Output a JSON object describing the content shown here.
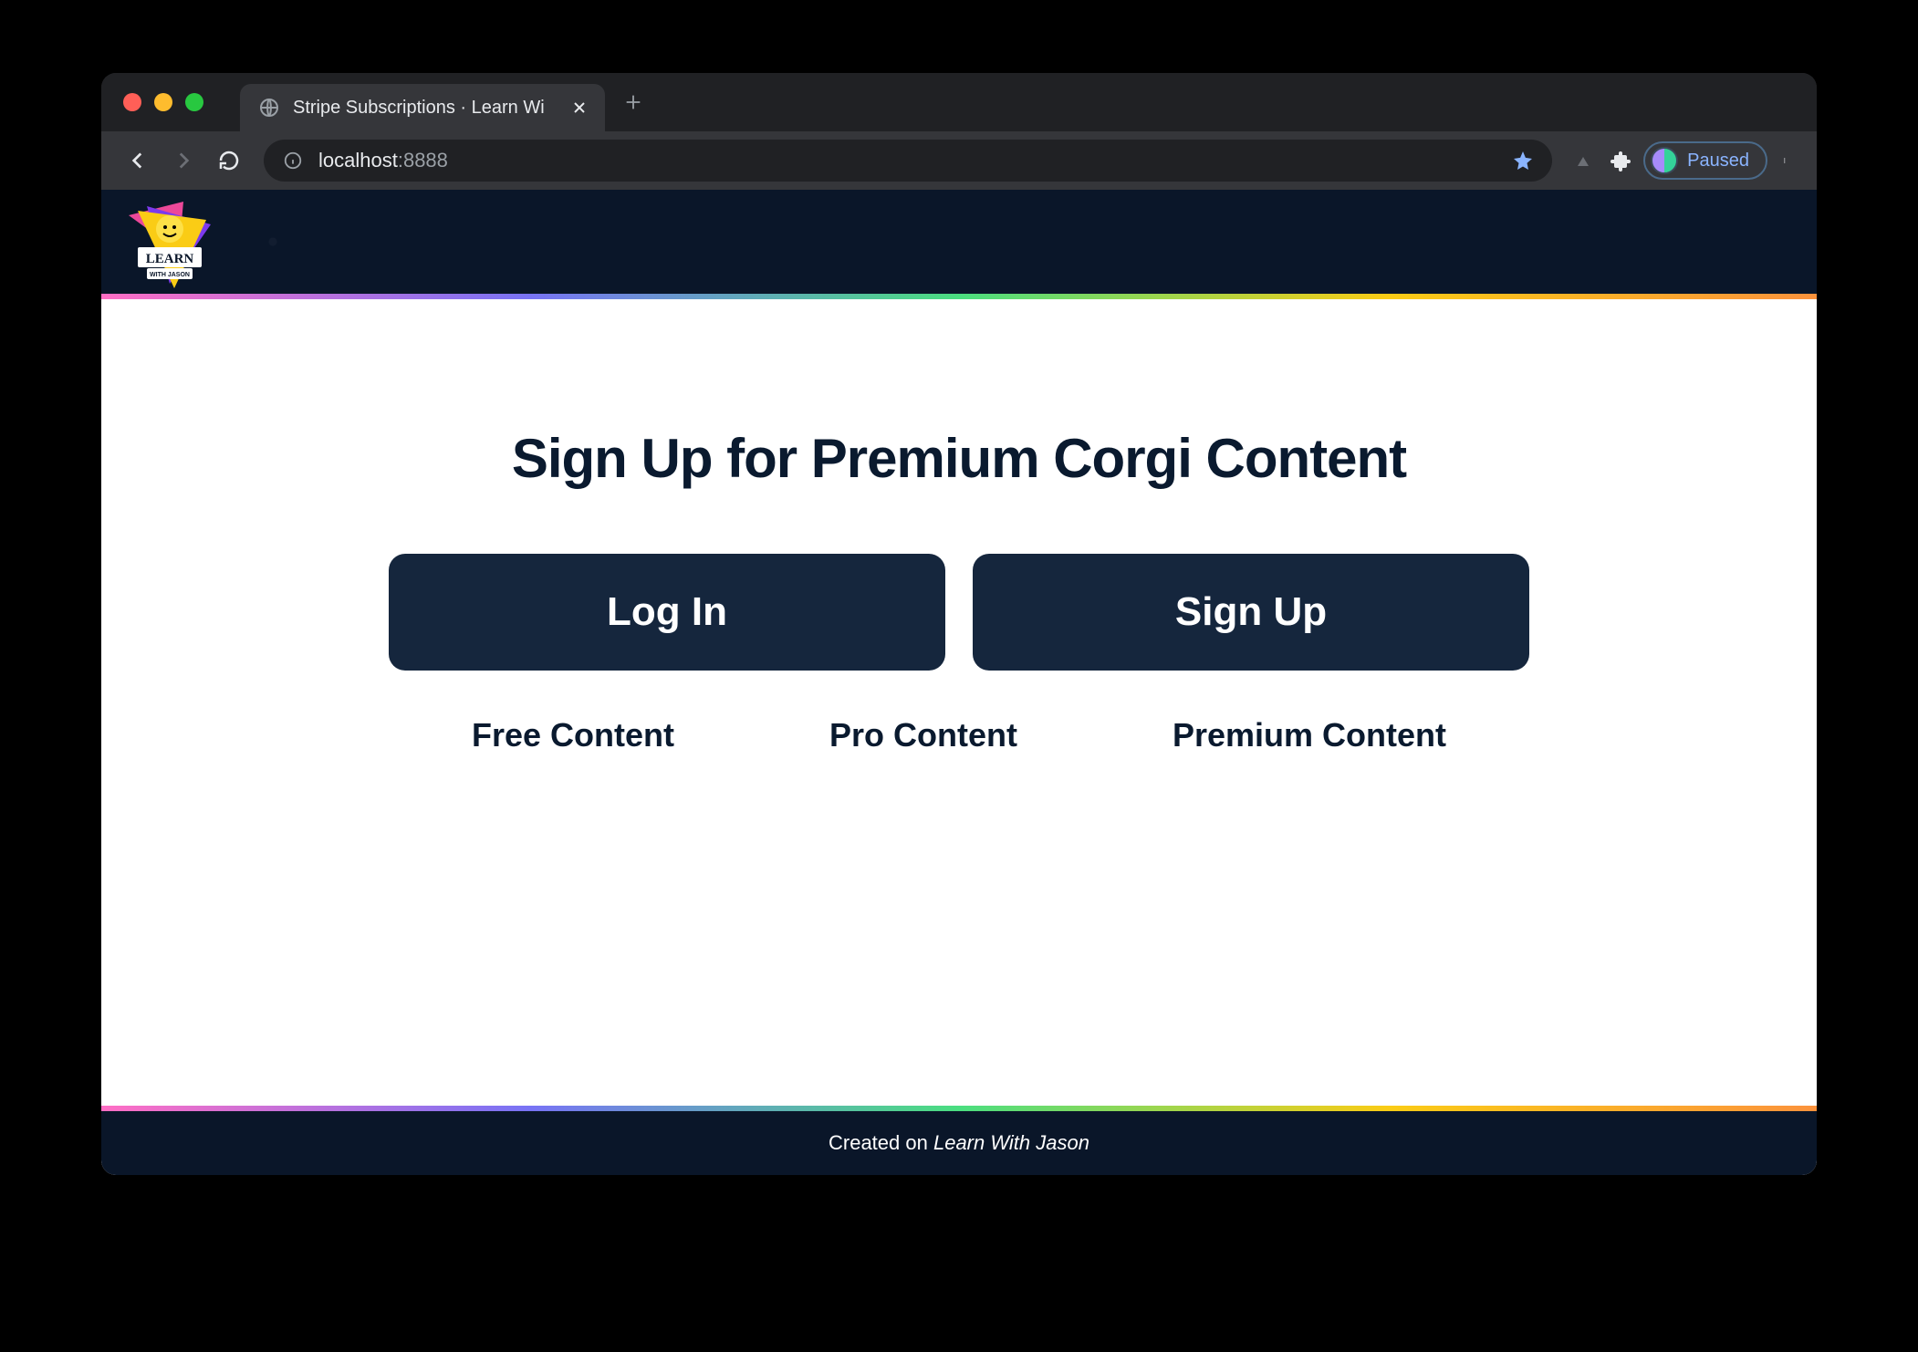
{
  "browser": {
    "tab_title": "Stripe Subscriptions · Learn Wi",
    "url_host": "localhost",
    "url_port": ":8888",
    "profile_label": "Paused"
  },
  "page": {
    "heading": "Sign Up for Premium Corgi Content",
    "buttons": {
      "login": "Log In",
      "signup": "Sign Up"
    },
    "tiers": [
      "Free Content",
      "Pro Content",
      "Premium Content"
    ],
    "footer_prefix": "Created on ",
    "footer_brand": "Learn With Jason",
    "logo": {
      "top_text": "LEARN",
      "bottom_text": "WITH JASON"
    }
  },
  "colors": {
    "dark_navy": "#0a1629",
    "button_navy": "#15263d",
    "accent_blue": "#8ab4ff"
  }
}
